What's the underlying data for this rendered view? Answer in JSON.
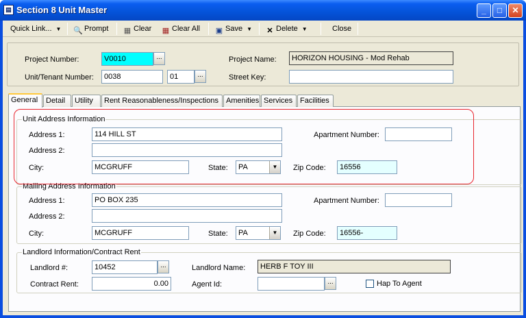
{
  "window": {
    "title": "Section 8 Unit Master",
    "minimize_icon": "minimize-icon",
    "maximize_icon": "maximize-icon",
    "close_icon": "close-icon"
  },
  "toolbar": {
    "quick_link": "Quick Link...",
    "prompt": "Prompt",
    "clear": "Clear",
    "clear_all": "Clear All",
    "save": "Save",
    "delete": "Delete",
    "close": "Close"
  },
  "header": {
    "project_number_label": "Project Number:",
    "project_number": "V0010",
    "project_name_label": "Project Name:",
    "project_name": "HORIZON HOUSING - Mod Rehab",
    "unit_tenant_label": "Unit/Tenant Number:",
    "unit_number": "0038",
    "tenant_number": "01",
    "street_key_label": "Street Key:",
    "street_key": ""
  },
  "tabs": [
    "General",
    "Detail",
    "Utility",
    "Rent Reasonableness/Inspections",
    "Amenities",
    "Services",
    "Facilities"
  ],
  "unit_address": {
    "title": "Unit Address Information",
    "address1_label": "Address 1:",
    "address1": "114 HILL ST",
    "address2_label": "Address 2:",
    "address2": "",
    "apt_label": "Apartment Number:",
    "apt": "",
    "city_label": "City:",
    "city": "MCGRUFF",
    "state_label": "State:",
    "state": "PA",
    "zip_label": "Zip Code:",
    "zip": "16556"
  },
  "mailing_address": {
    "title": "Mailing Address Information",
    "address1_label": "Address 1:",
    "address1": "PO BOX 235",
    "address2_label": "Address 2:",
    "address2": "",
    "apt_label": "Apartment Number:",
    "apt": "",
    "city_label": "City:",
    "city": "MCGRUFF",
    "state_label": "State:",
    "state": "PA",
    "zip_label": "Zip Code:",
    "zip": "16556-"
  },
  "landlord": {
    "title": "Landlord Information/Contract Rent",
    "landlord_num_label": "Landlord #:",
    "landlord_num": "10452",
    "landlord_name_label": "Landlord Name:",
    "landlord_name": "HERB F TOY III",
    "contract_rent_label": "Contract Rent:",
    "contract_rent": "0.00",
    "agent_id_label": "Agent Id:",
    "agent_id": "",
    "hap_to_agent_label": "Hap To Agent",
    "hap_to_agent": false
  },
  "ellipsis": "...",
  "dropdown_arrow": "▼"
}
